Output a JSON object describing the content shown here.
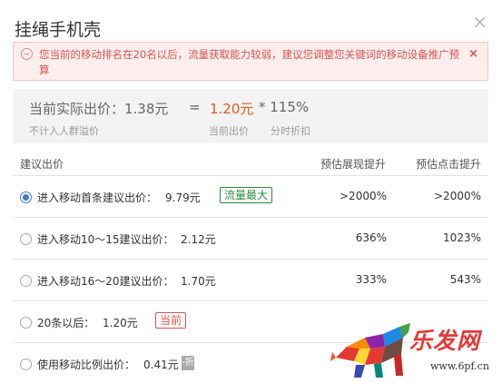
{
  "dialog": {
    "title": "挂绳手机壳",
    "close_glyph": "×"
  },
  "warning": {
    "text": "您当前的移动排名在20名以后，流量获取能力较弱，建议您调整您关键词的移动设备推广预算",
    "close_glyph": "×"
  },
  "price": {
    "actual_label": "当前实际出价：1.38元",
    "equals": "=",
    "current_bid": "1.20元",
    "multiplier": "* 115%",
    "note_crowd": "不计入人群溢价",
    "note_current_bid": "当前出价",
    "note_time_discount": "分时折扣"
  },
  "table": {
    "headers": {
      "suggested_bid": "建议出价",
      "est_impression": "预估展现提升",
      "est_click": "预估点击提升"
    },
    "rows": [
      {
        "label": "进入移动首条建议出价：",
        "value": "9.79元",
        "tag": "流量最大",
        "impression": ">2000%",
        "click": ">2000%",
        "selected": true
      },
      {
        "label": "进入移动10～15建议出价：",
        "value": "2.12元",
        "impression": "636%",
        "click": "1023%",
        "selected": false
      },
      {
        "label": "进入移动16～20建议出价：",
        "value": "1.70元",
        "impression": "333%",
        "click": "543%",
        "selected": false
      },
      {
        "label": "20条以后：",
        "value": "1.20元",
        "tag": "当前",
        "selected": false
      },
      {
        "label": "使用移动比例出价：",
        "value": "0.41元",
        "tag": "-折",
        "selected": false
      }
    ]
  },
  "watermark": {
    "text": "乐发网",
    "url": "www.6pf.cn"
  }
}
